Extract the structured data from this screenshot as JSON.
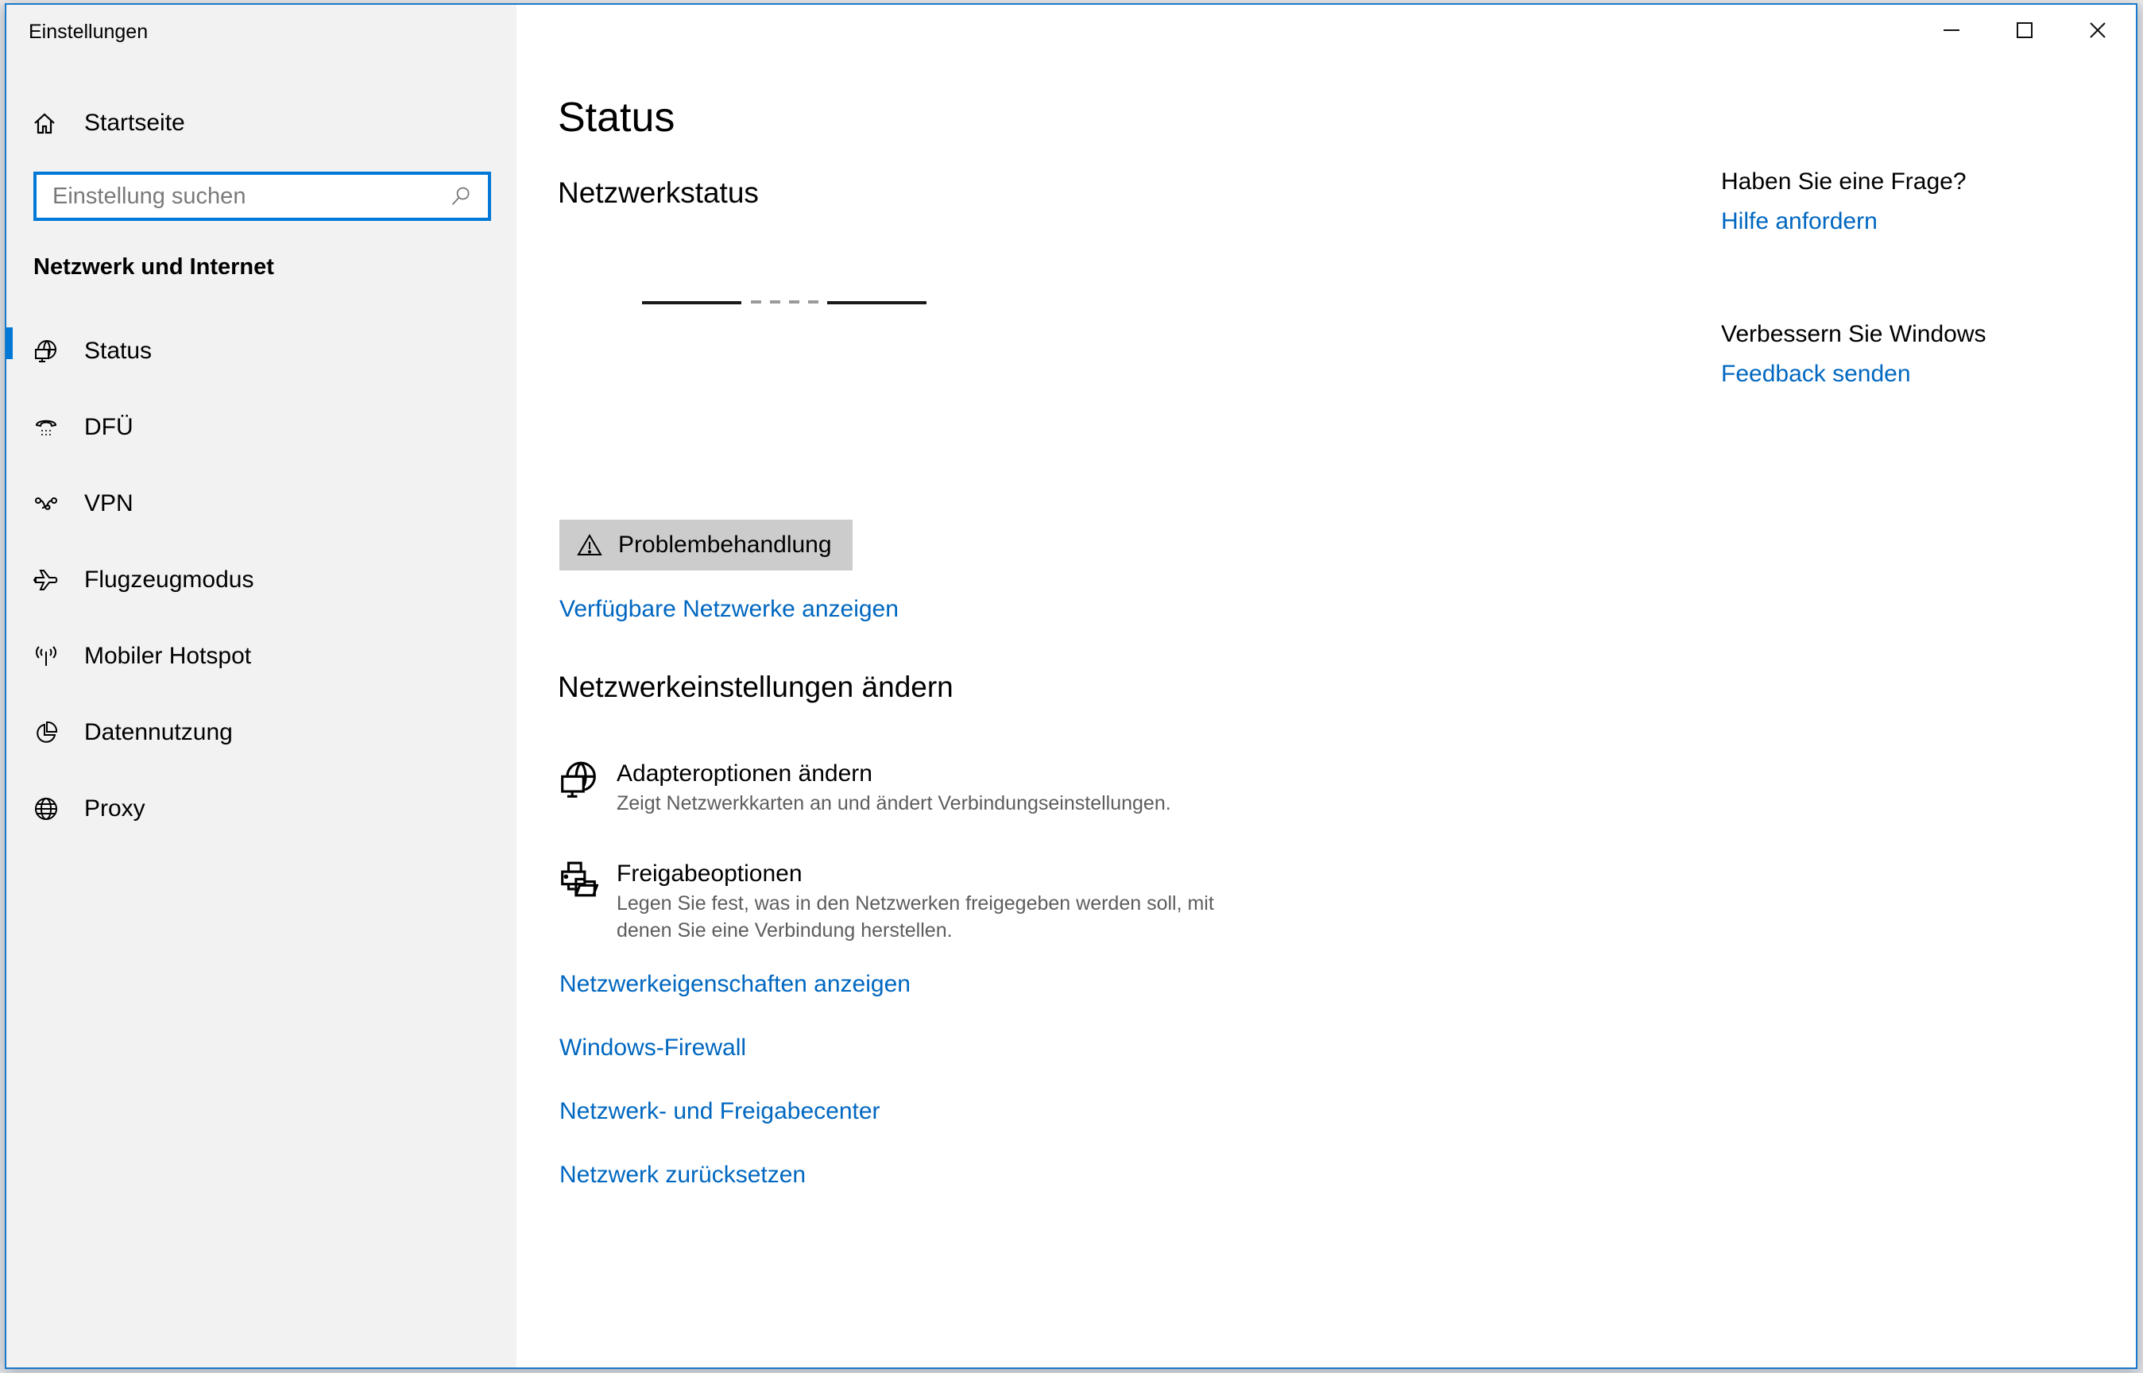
{
  "window": {
    "title": "Einstellungen",
    "controls": {
      "minimize": "minimize",
      "maximize": "maximize",
      "close": "close"
    }
  },
  "sidebar": {
    "home_label": "Startseite",
    "search": {
      "placeholder": "Einstellung suchen",
      "value": ""
    },
    "section_heading": "Netzwerk und Internet",
    "items": [
      {
        "label": "Status",
        "icon": "network-status-icon",
        "active": true
      },
      {
        "label": "DFÜ",
        "icon": "dial-up-phone-icon",
        "active": false
      },
      {
        "label": "VPN",
        "icon": "vpn-icon",
        "active": false
      },
      {
        "label": "Flugzeugmodus",
        "icon": "airplane-icon",
        "active": false
      },
      {
        "label": "Mobiler Hotspot",
        "icon": "hotspot-icon",
        "active": false
      },
      {
        "label": "Datennutzung",
        "icon": "data-usage-icon",
        "active": false
      },
      {
        "label": "Proxy",
        "icon": "globe-icon",
        "active": false
      }
    ]
  },
  "main": {
    "title": "Status",
    "network_status": {
      "heading": "Netzwerkstatus",
      "troubleshoot_button": "Problembehandlung",
      "available_networks_link": "Verfügbare Netzwerke anzeigen"
    },
    "change_settings": {
      "heading": "Netzwerkeinstellungen ändern",
      "items": [
        {
          "title": "Adapteroptionen ändern",
          "description": "Zeigt Netzwerkkarten an und ändert Verbindungseinstellungen.",
          "icon": "adapter-globe-icon"
        },
        {
          "title": "Freigabeoptionen",
          "description": "Legen Sie fest, was in den Netzwerken freigegeben werden soll, mit denen Sie eine Verbindung herstellen.",
          "icon": "sharing-printer-folder-icon"
        }
      ],
      "links": [
        "Netzwerkeigenschaften anzeigen",
        "Windows-Firewall",
        "Netzwerk- und Freigabecenter",
        "Netzwerk zurücksetzen"
      ]
    }
  },
  "aside": {
    "question": {
      "heading": "Haben Sie eine Frage?",
      "link": "Hilfe anfordern"
    },
    "feedback": {
      "heading": "Verbessern Sie Windows",
      "link": "Feedback senden"
    }
  },
  "colors": {
    "accent": "#0078d7",
    "link": "#0067c0",
    "sidebar_bg": "#f2f2f2",
    "button_bg": "#cccccc"
  }
}
